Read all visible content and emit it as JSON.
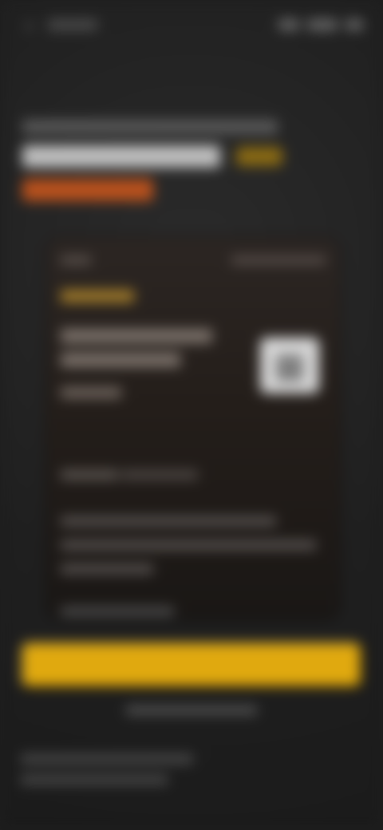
{
  "status_bar": {
    "back_icon": "‹",
    "time": ""
  },
  "promo": {
    "qr_icon": "▦"
  },
  "actions": {
    "primary_button": ""
  }
}
